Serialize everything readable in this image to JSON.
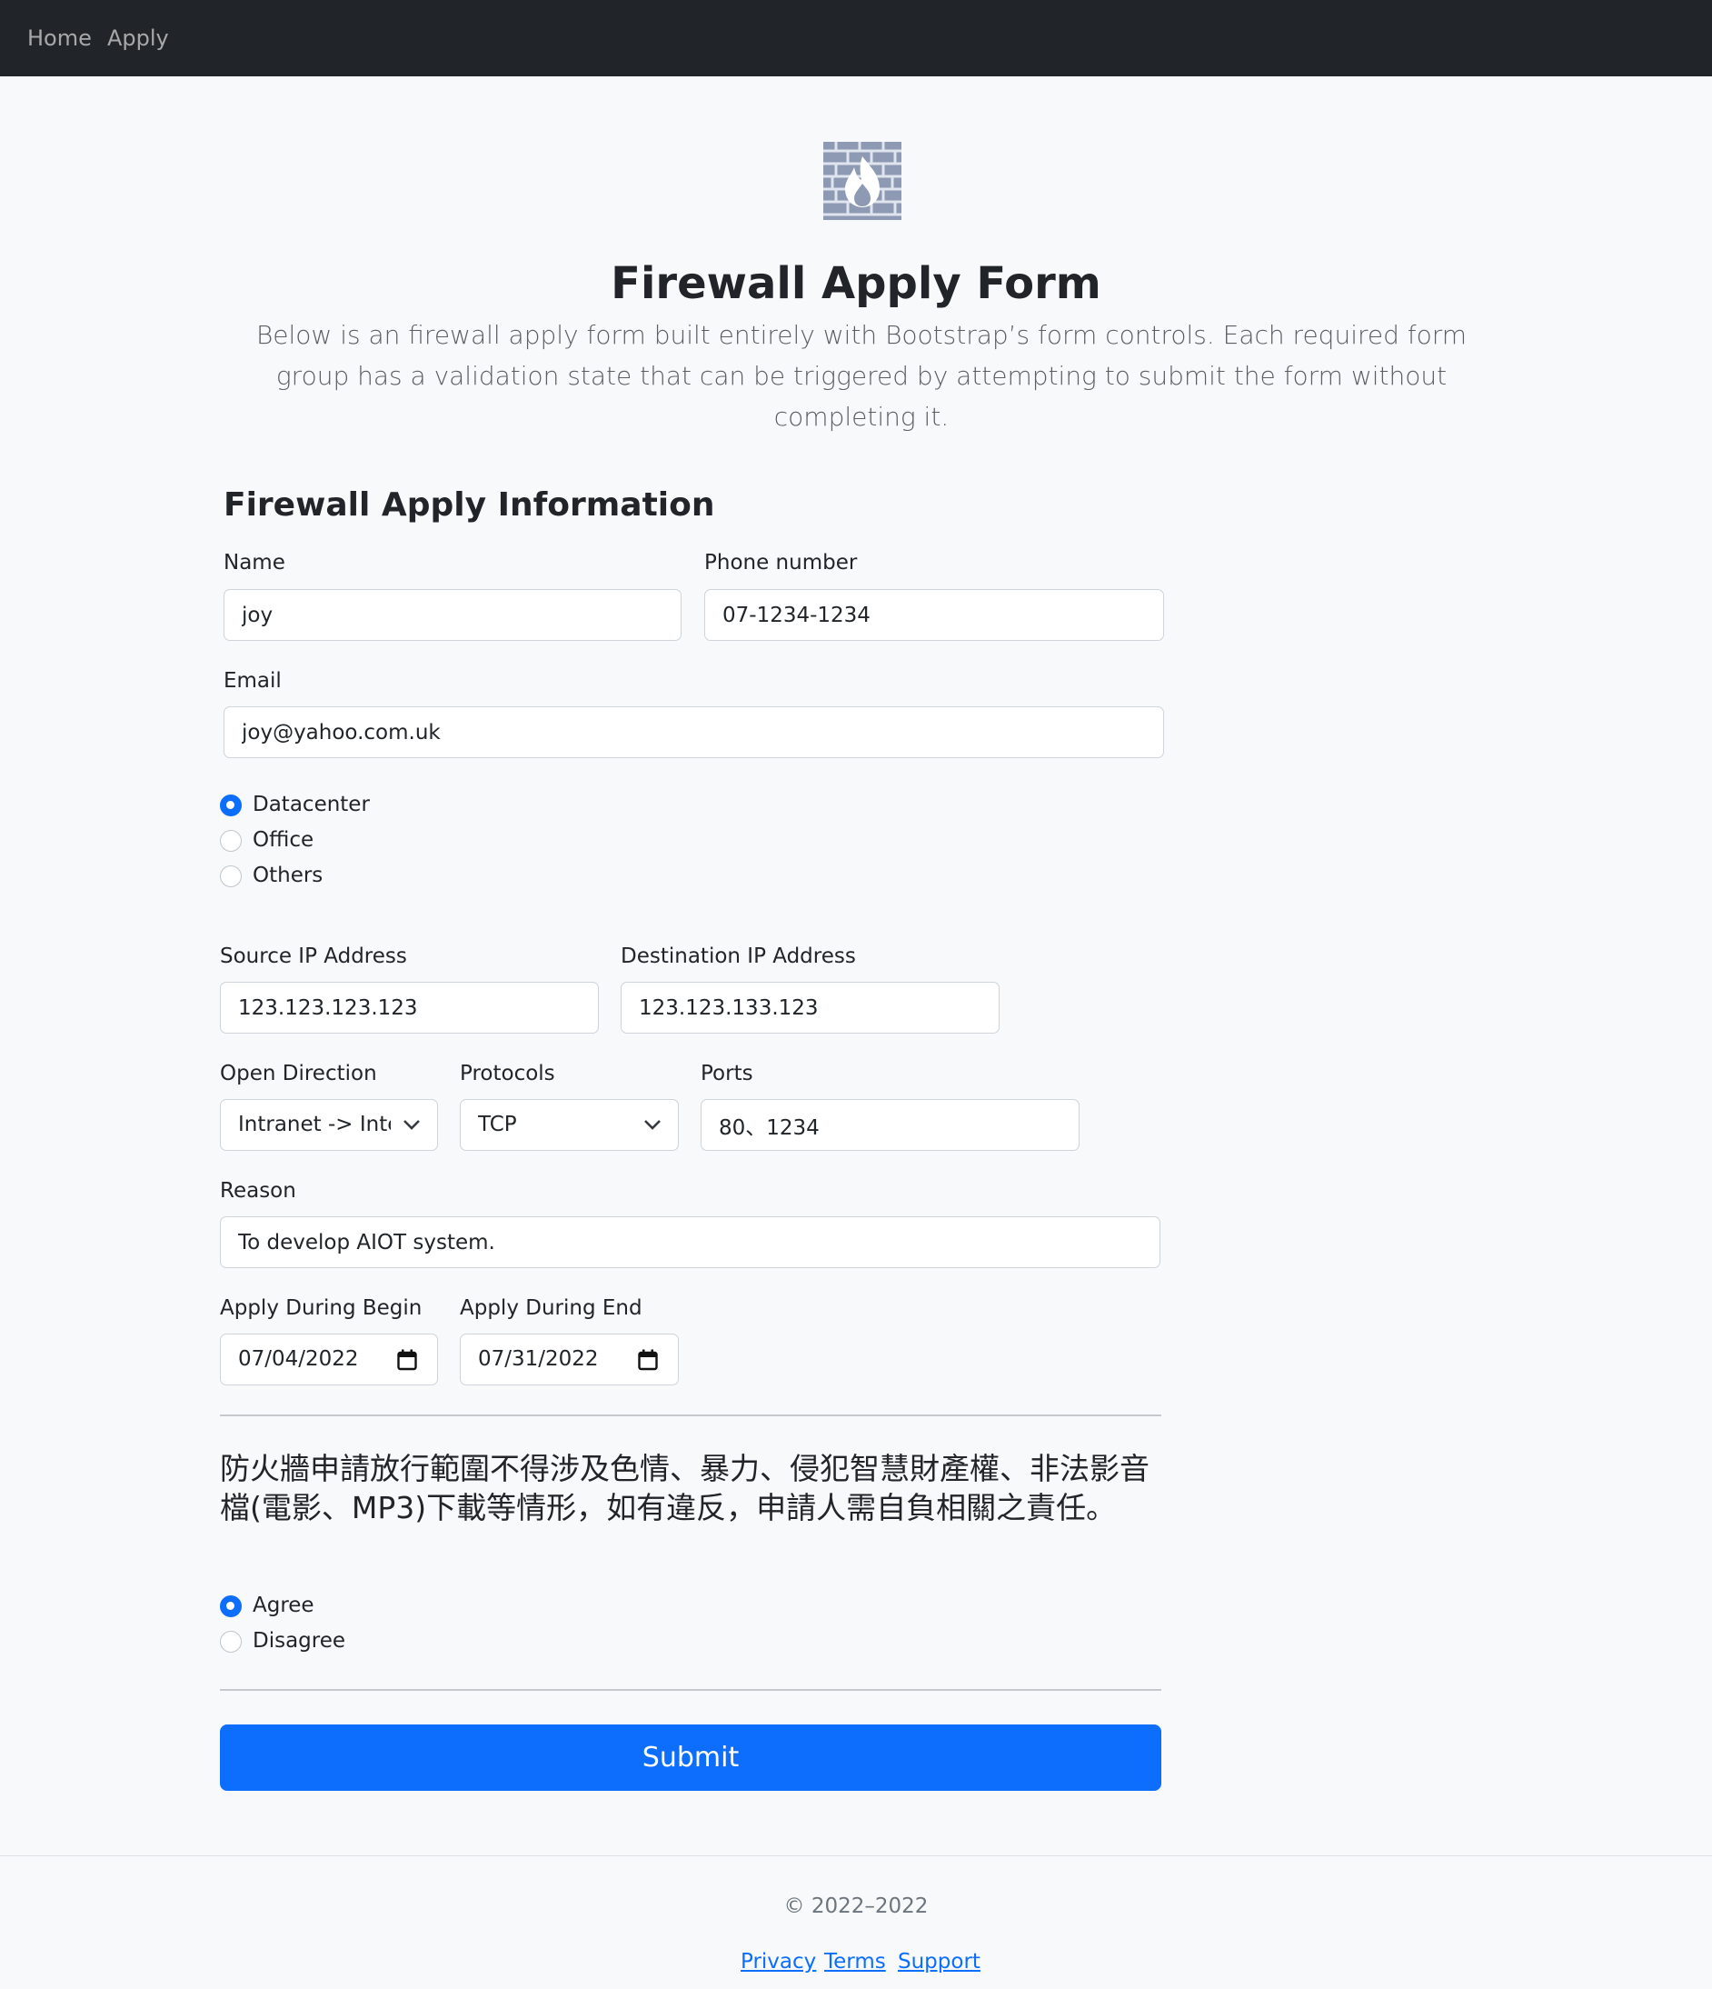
{
  "nav": {
    "home": "Home",
    "apply": "Apply"
  },
  "header": {
    "logo_icon": "firewall-icon",
    "title": "Firewall Apply Form",
    "lead": "Below is an firewall apply form built entirely with Bootstrap’s form controls. Each required form group has a validation state that can be triggered by attempting to submit the form without completing it."
  },
  "form": {
    "section_title": "Firewall Apply Information",
    "name": {
      "label": "Name",
      "value": "joy"
    },
    "phone": {
      "label": "Phone number",
      "value": "07-1234-1234"
    },
    "email": {
      "label": "Email",
      "value": "joy@yahoo.com.uk"
    },
    "location": {
      "options": [
        "Datacenter",
        "Office",
        "Others"
      ],
      "selected": "Datacenter"
    },
    "source_ip": {
      "label": "Source IP Address",
      "value": "123.123.123.123"
    },
    "dest_ip": {
      "label": "Destination IP Address",
      "value": "123.123.133.123"
    },
    "direction": {
      "label": "Open Direction",
      "value": "Intranet -> Internet"
    },
    "protocols": {
      "label": "Protocols",
      "value": "TCP"
    },
    "ports": {
      "label": "Ports",
      "value": "80、1234"
    },
    "reason": {
      "label": "Reason",
      "value": "To develop AIOT system."
    },
    "begin": {
      "label": "Apply During Begin",
      "value": "07/04/2022"
    },
    "end": {
      "label": "Apply During End",
      "value": "07/31/2022"
    },
    "notice": "防火牆申請放行範圍不得涉及色情、暴力、侵犯智慧財產權、非法影音檔(電影、MP3)下載等情形，如有違反，申請人需自負相關之責任。",
    "consent": {
      "options": [
        "Agree",
        "Disagree"
      ],
      "selected": "Agree"
    },
    "submit": "Submit"
  },
  "footer": {
    "copyright": "© 2022–2022",
    "links": [
      "Privacy",
      "Terms",
      "Support"
    ]
  },
  "colors": {
    "primary": "#0d6efd",
    "navbar": "#212529",
    "background": "#f8f9fa"
  }
}
